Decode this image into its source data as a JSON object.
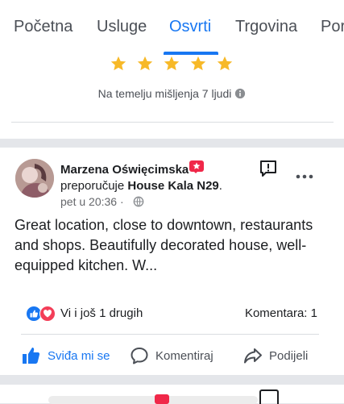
{
  "tabs": [
    {
      "label": "Početna"
    },
    {
      "label": "Usluge"
    },
    {
      "label": "Osvrti",
      "active": true
    },
    {
      "label": "Trgovina"
    },
    {
      "label": "Por"
    }
  ],
  "rating": {
    "stars": 5,
    "caption": "Na temelju mišljenja 7 ljudi",
    "star_color": "#f7b928"
  },
  "post": {
    "author": "Marzena Oświęcimska",
    "recommends_prefix": "preporučuje",
    "page_name": "House Kala N29",
    "recommends_suffix": ".",
    "time": "pet u 20:36 ·",
    "text": "Great location, close to downtown, restaurants and shops.  Beautifully decorated house, well-equipped kitchen.  W...",
    "reactions_text": "Vi i još 1 drugih",
    "comments_text": "Komentara: 1",
    "actions": {
      "like": "Sviđa mi se",
      "comment": "Komentiraj",
      "share": "Podijeli"
    }
  },
  "colors": {
    "accent": "#1877f2",
    "love": "#f33e58",
    "badge": "#f02849"
  }
}
